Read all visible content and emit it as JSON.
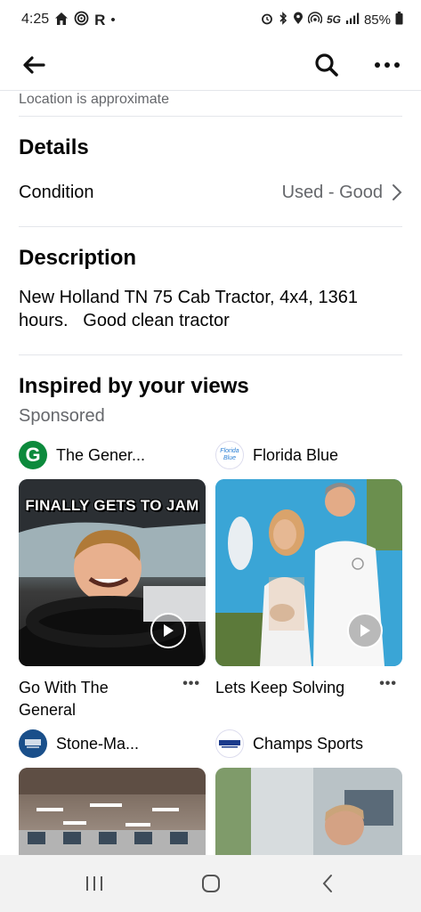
{
  "status_bar": {
    "time": "4:25",
    "left_icons": [
      "home-icon",
      "wifi-target-icon",
      "r-app-icon",
      "dot-icon"
    ],
    "r_glyph": "R",
    "dot_glyph": "•",
    "network": "5G",
    "battery": "85%"
  },
  "toolbar": {
    "back_icon": "back-arrow-icon",
    "search_icon": "search-icon",
    "more_icon": "more-icon"
  },
  "location_note": "Location is approximate",
  "details": {
    "title": "Details",
    "condition_label": "Condition",
    "condition_value": "Used - Good"
  },
  "description": {
    "title": "Description",
    "text": "New Holland TN 75 Cab Tractor, 4x4, 1361 hours.   Good clean tractor"
  },
  "inspired": {
    "title": "Inspired by your views",
    "sponsored": "Sponsored",
    "ads": [
      {
        "advertiser": "The Gener...",
        "logo_letter": "G",
        "logo_color": "#0c8a3c",
        "media_caption": "FINALLY GETS TO JAM",
        "title": "Go With The General",
        "more": "•••"
      },
      {
        "advertiser": "Florida Blue",
        "logo_text": "Florida Blue",
        "logo_color": "#2a7fd4",
        "title": "Lets Keep Solving",
        "more": "•••"
      },
      {
        "advertiser": "Stone-Ma...",
        "logo_color": "#1a4f8a"
      },
      {
        "advertiser": "Champs Sports",
        "logo_color": "#1b3b8c"
      }
    ]
  },
  "colors": {
    "text_primary": "#050505",
    "text_secondary": "#65676b",
    "divider": "#e4e6eb",
    "nav_background": "#f2f2f2"
  }
}
